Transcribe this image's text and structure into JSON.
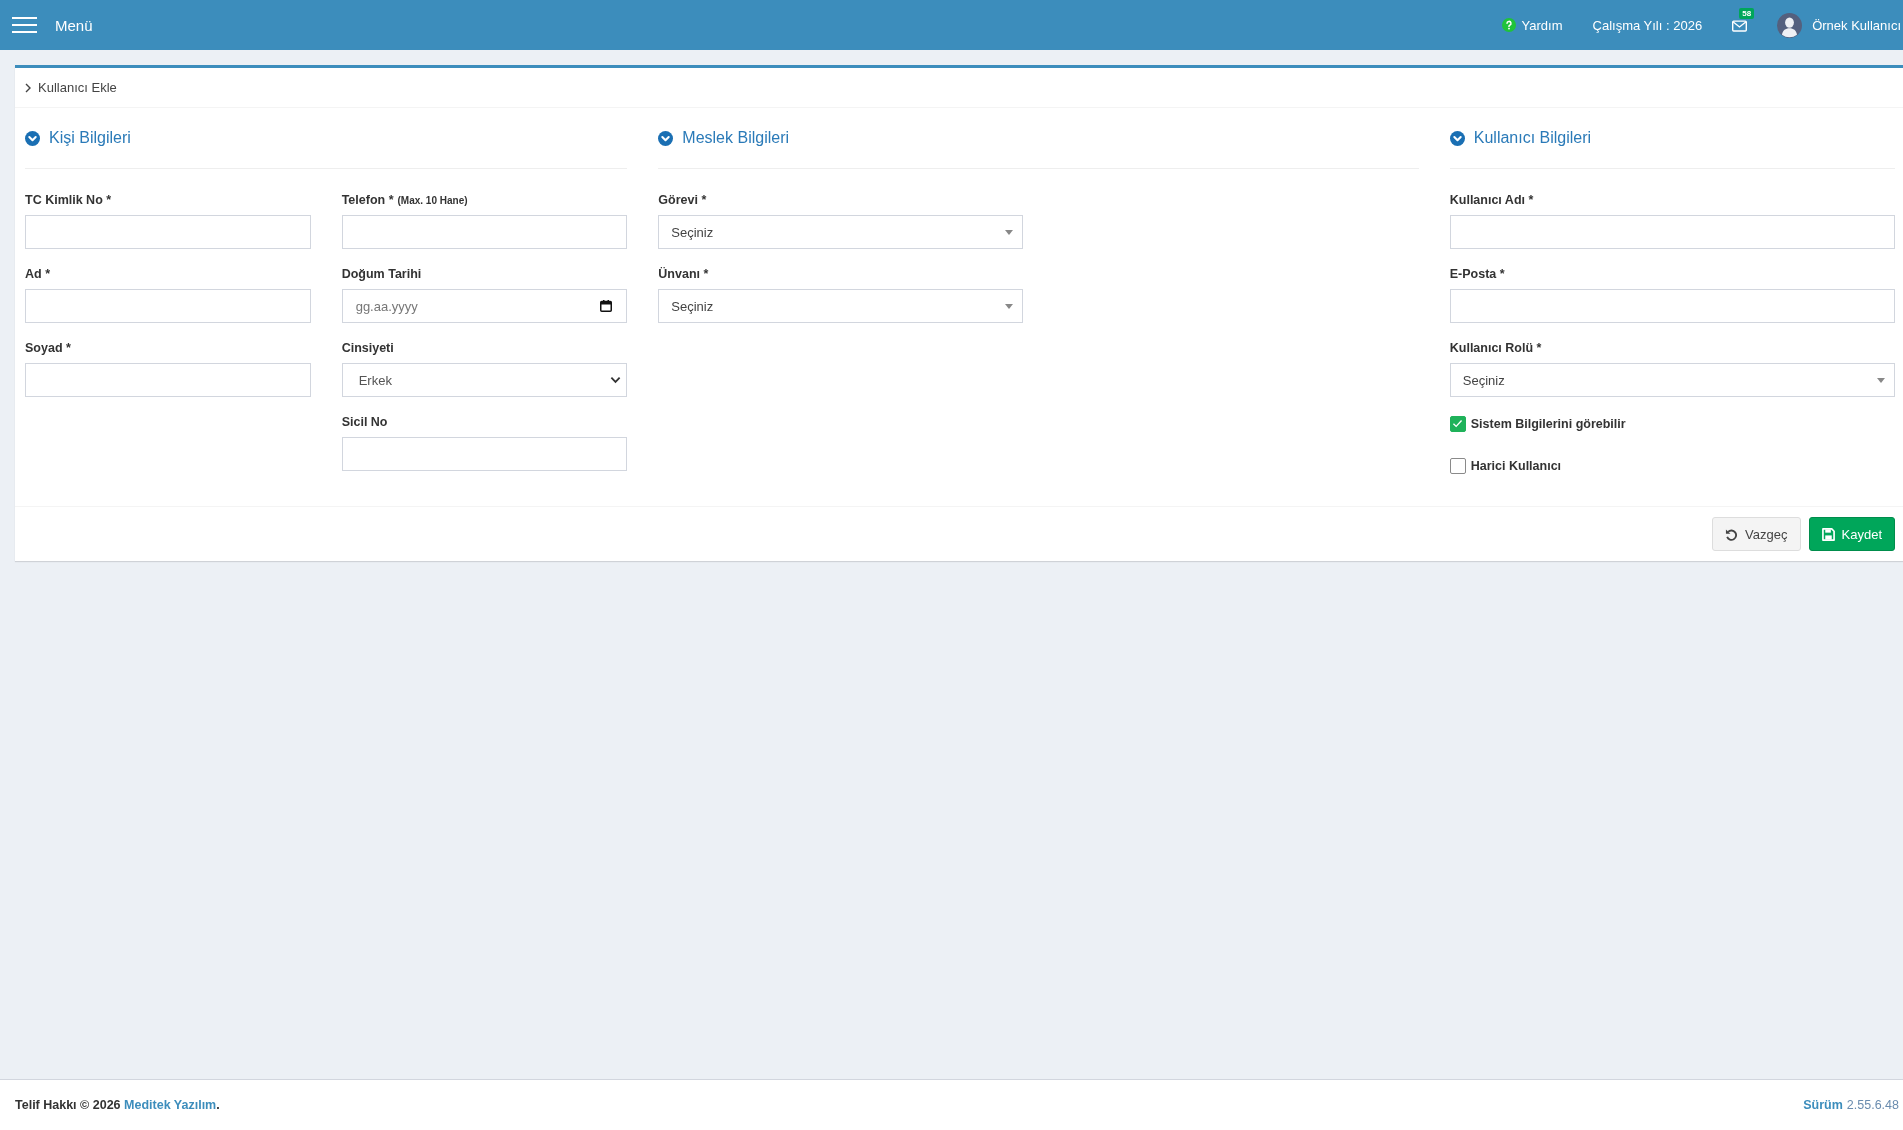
{
  "topbar": {
    "menu_label": "Menü",
    "help": "Yardım",
    "work_year": "Çalışma Yılı : 2026",
    "mail_badge": "58",
    "user_name": "Örnek Kullanıcı"
  },
  "breadcrumb": [
    "Kullanıcı Ekle"
  ],
  "sections": [
    {
      "title": "Kişi Bilgileri",
      "columns": [
        [
          {
            "kind": "text",
            "label": "TC Kimlik No *"
          },
          {
            "kind": "text",
            "label": "Ad *"
          },
          {
            "kind": "text",
            "label": "Soyad *"
          }
        ],
        [
          {
            "kind": "text",
            "label": "Telefon *",
            "hint": "(Max. 10 Hane)"
          },
          {
            "kind": "date",
            "label": "Doğum Tarihi",
            "placeholder": "gg.aa.yyyy"
          },
          {
            "kind": "select",
            "label": "Cinsiyeti",
            "value": "Erkek"
          },
          {
            "kind": "text",
            "label": "Sicil No"
          }
        ]
      ]
    },
    {
      "title": "Meslek Bilgileri",
      "columns": [
        [
          {
            "kind": "combo",
            "label": "Görevi *",
            "value": "Seçiniz"
          },
          {
            "kind": "combo",
            "label": "Ünvanı *",
            "value": "Seçiniz"
          }
        ]
      ]
    },
    {
      "title": "Kullanıcı Bilgileri",
      "columns": [
        [
          {
            "kind": "text",
            "label": "Kullanıcı Adı *"
          },
          {
            "kind": "text",
            "label": "E-Posta *"
          },
          {
            "kind": "combo",
            "label": "Kullanıcı Rolü *",
            "value": "Seçiniz"
          },
          {
            "kind": "checkbox",
            "label": "Sistem Bilgilerini görebilir",
            "checked": true
          },
          {
            "kind": "checkbox",
            "label": "Harici Kullanıcı",
            "checked": false
          }
        ]
      ]
    }
  ],
  "buttons": [
    {
      "kind": "default",
      "label": "Vazgeç"
    },
    {
      "kind": "primary",
      "label": "Kaydet"
    }
  ],
  "footer": {
    "copyright": "Telif Hakkı © 2026",
    "company": "Meditek Yazılım",
    "suffix": ".",
    "version_label": "Sürüm",
    "version": "2.55.6.48"
  }
}
